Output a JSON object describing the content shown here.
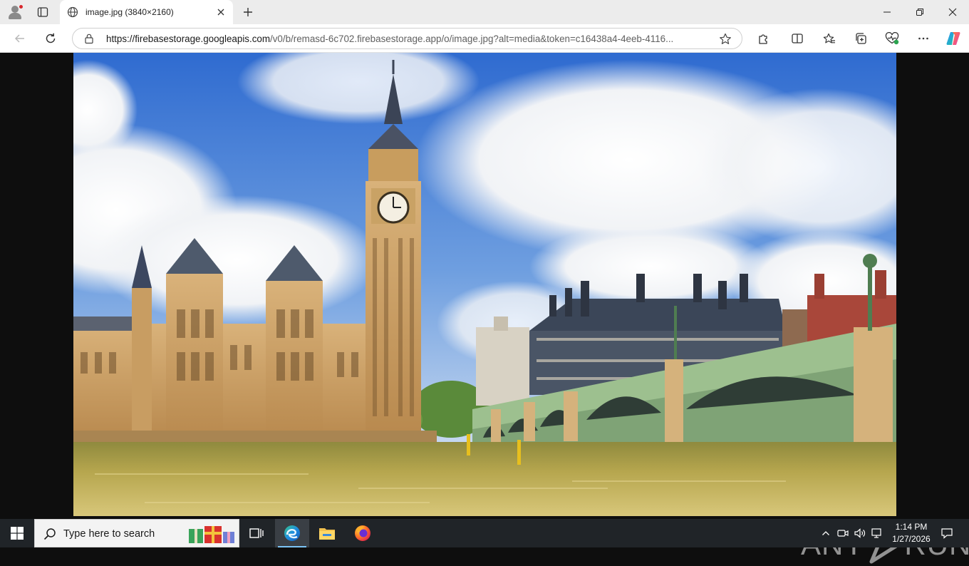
{
  "browser": {
    "tab": {
      "title": "image.jpg (3840×2160)"
    },
    "address_bar": {
      "url_host": "https://firebasestorage.googleapis.com",
      "url_path": "/v0/b/remasd-6c702.firebasestorage.app/o/image.jpg?alt=media&token=c16438a4-4eeb-4116..."
    },
    "icons": {
      "profile": "profile-icon",
      "tab_actions": "tab-actions-icon",
      "new_tab": "plus-icon",
      "back": "back-arrow-icon",
      "refresh": "refresh-icon",
      "favorite": "star-icon",
      "extensions": "puzzle-icon",
      "split_screen": "split-screen-icon",
      "favorites": "favorites-icon",
      "collections": "collections-icon",
      "browser_essentials": "heart-pulse-icon",
      "menu": "ellipsis-icon",
      "copilot": "copilot-icon"
    }
  },
  "content": {
    "image_subject": "Big Ben clock tower, Houses of Parliament and Westminster Bridge over the Thames",
    "watermark": {
      "left": "ANY",
      "right": "RUN"
    }
  },
  "taskbar": {
    "search_placeholder": "Type here to search",
    "clock": {
      "time": "1:14 PM",
      "date": "1/27/2026"
    },
    "apps": [
      "task-view",
      "edge",
      "file-explorer",
      "firefox"
    ]
  },
  "colors": {
    "tab_strip": "#ececec",
    "toolbar": "#ffffff",
    "viewport_bg": "#0e0e0e",
    "taskbar": "#202428",
    "sky": "#3f78d4",
    "stone": "#c79a5e",
    "bridge": "#8fb48a",
    "river": "#a99a45"
  }
}
